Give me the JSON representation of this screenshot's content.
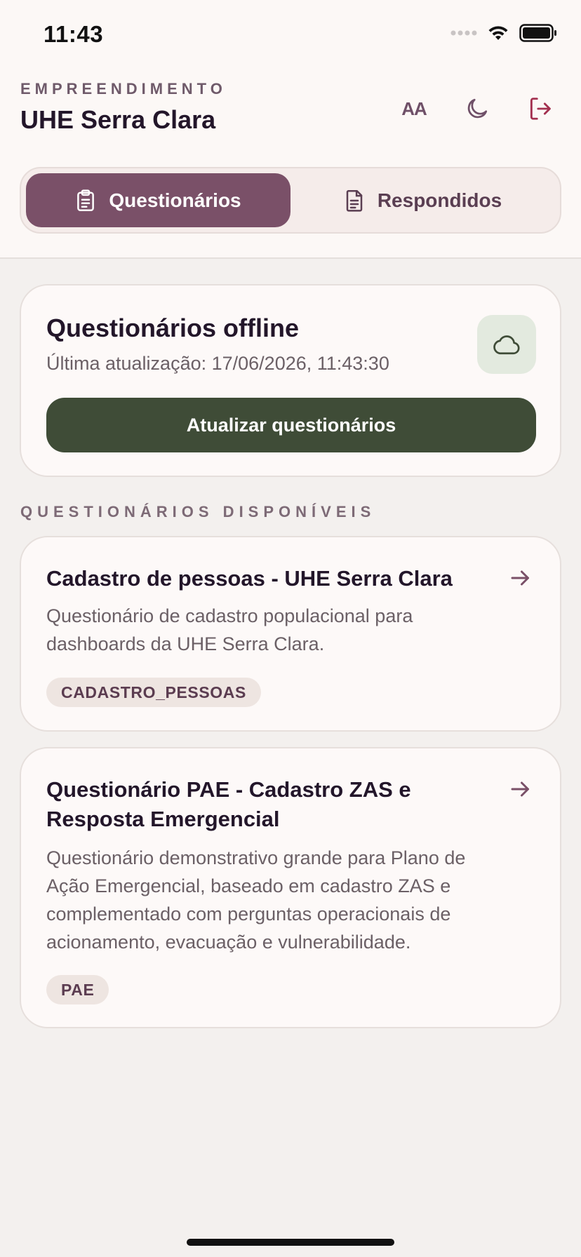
{
  "status_bar": {
    "time": "11:43"
  },
  "header": {
    "eyebrow": "EMPREENDIMENTO",
    "project_name": "UHE Serra Clara",
    "font_size_label": "AA",
    "icons": [
      "font-size-icon",
      "moon-icon",
      "logout-icon"
    ]
  },
  "tabs": [
    {
      "label": "Questionários",
      "icon": "clipboard-icon",
      "active": true
    },
    {
      "label": "Respondidos",
      "icon": "document-icon",
      "active": false
    }
  ],
  "offline": {
    "title": "Questionários offline",
    "last_update": "Última atualização: 17/06/2026, 11:43:30",
    "icon": "cloud-icon",
    "button_label": "Atualizar questionários"
  },
  "section_label": "QUESTIONÁRIOS DISPONÍVEIS",
  "questionnaires": [
    {
      "title": "Cadastro de pessoas - UHE Serra Clara",
      "description": "Questionário de cadastro populacional para dashboards da UHE Serra Clara.",
      "tag": "CADASTRO_PESSOAS"
    },
    {
      "title": "Questionário PAE - Cadastro ZAS e Resposta Emergencial",
      "description": "Questionário demonstrativo grande para Plano de Ação Emergencial, baseado em cadastro ZAS e complementado com perguntas operacionais de acionamento, evacuação e vulnerabilidade.",
      "tag": "PAE"
    }
  ],
  "colors": {
    "accent": "#7a5068",
    "button_green": "#3f4c37",
    "logout": "#a3304f",
    "background": "#f3f0ee"
  }
}
